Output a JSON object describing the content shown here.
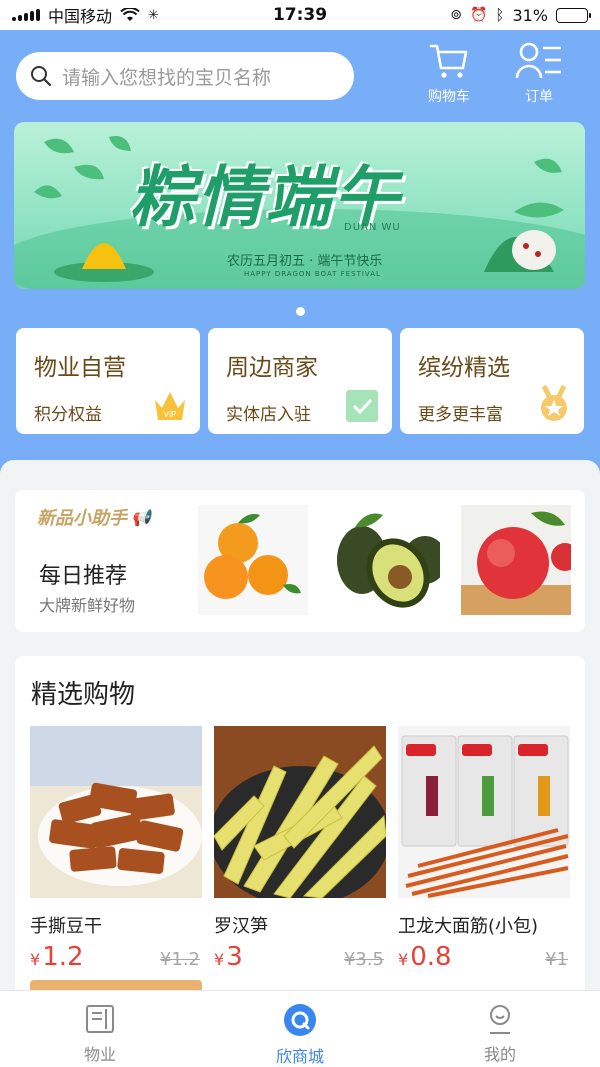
{
  "status": {
    "carrier": "中国移动",
    "time": "17:39",
    "battery": "31%",
    "battery_level": 0.31,
    "battery_color": "#3ed33a"
  },
  "search": {
    "placeholder": "请输入您想找的宝贝名称",
    "icon": "search-icon"
  },
  "header": {
    "cart_label": "购物车",
    "orders_label": "订单"
  },
  "banner": {
    "title": "粽情端午",
    "english": "DUAN WU",
    "subtitle": "农历五月初五 · 端午节快乐",
    "subtitle_en": "HAPPY DRAGON BOAT FESTIVAL"
  },
  "categories": [
    {
      "title": "物业自营",
      "subtitle": "积分权益",
      "icon": "vip-crown-icon"
    },
    {
      "title": "周边商家",
      "subtitle": "实体店入驻",
      "icon": "check-icon"
    },
    {
      "title": "缤纷精选",
      "subtitle": "更多更丰富",
      "icon": "medal-icon"
    }
  ],
  "recommend": {
    "badge": "新品小助手",
    "title": "每日推荐",
    "subtitle": "大牌新鲜好物",
    "fruits": [
      "orange-image",
      "avocado-image",
      "apple-image"
    ]
  },
  "selected": {
    "heading": "精选购物",
    "products": [
      {
        "name": "手撕豆干",
        "price": "1.2",
        "old_price": "¥1.2"
      },
      {
        "name": "罗汉笋",
        "price": "3",
        "old_price": "¥3.5"
      },
      {
        "name": "卫龙大面筋(小包)",
        "price": "0.8",
        "old_price": "¥1"
      }
    ],
    "currency": "¥"
  },
  "tabs": [
    {
      "label": "物业",
      "icon": "document-icon"
    },
    {
      "label": "欣商城",
      "icon": "mall-icon"
    },
    {
      "label": "我的",
      "icon": "user-icon"
    }
  ],
  "colors": {
    "accent": "#3a86f0",
    "price": "#e8413c",
    "header_bg": "#78adf7",
    "category_text": "#6b4a19"
  }
}
